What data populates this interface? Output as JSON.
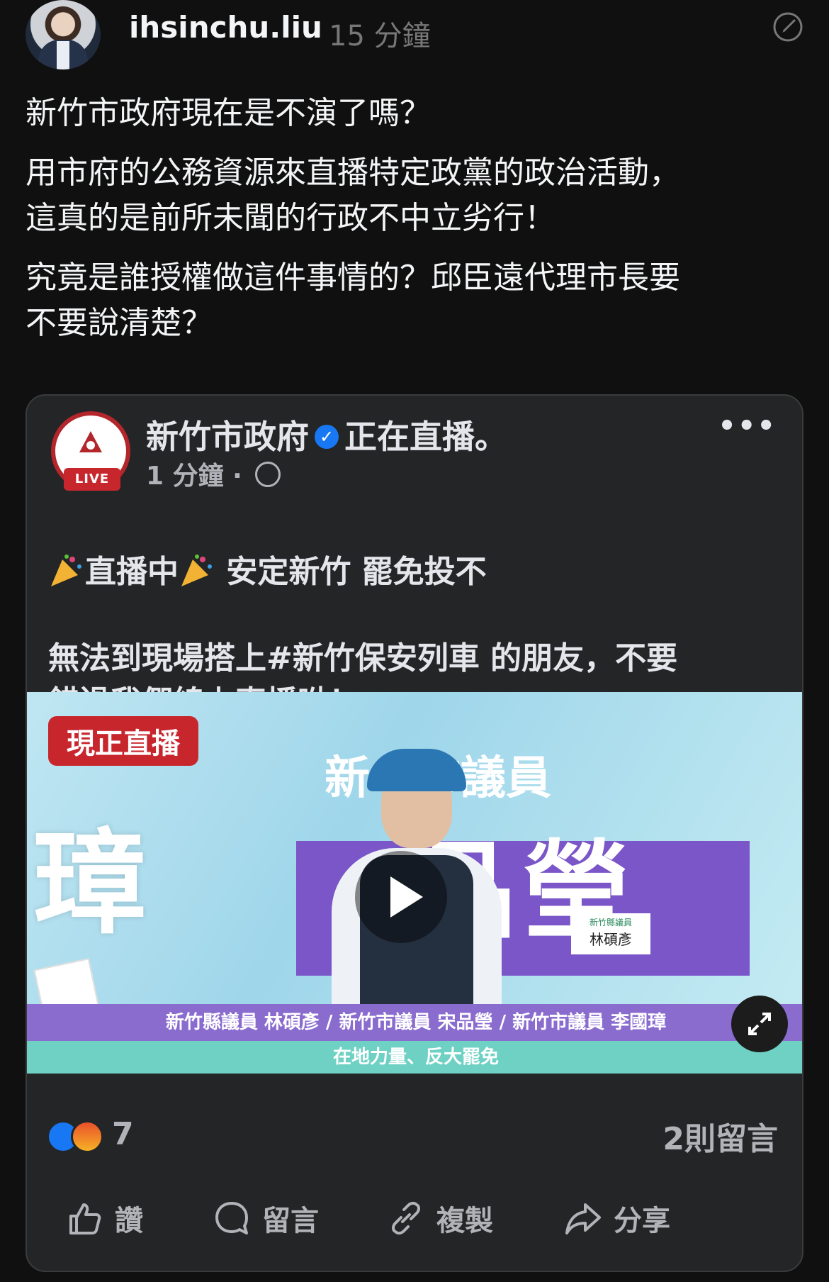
{
  "post": {
    "username": "ihsinchu.liu",
    "timestamp": "15 分鐘",
    "paragraphs": [
      "新竹市政府現在是不演了嗎？",
      "用市府的公務資源來直播特定政黨的政治活動，\n這真的是前所未聞的行政不中立劣行！",
      "究竟是誰授權做這件事情的？邱臣遠代理市長要\n不要說清楚？"
    ]
  },
  "card": {
    "page_name": "新竹市政府",
    "live_status": "正在直播。",
    "live_badge": "LIVE",
    "time": "1 分鐘 · ",
    "line1_a": "直播中",
    "line1_b": "安定新竹 罷免投不",
    "line2": "無法到現場搭上#新竹保安列車 的朋友，不要\n錯過我們線上直播呦！",
    "video": {
      "live_now": "現正直播",
      "name_tag": "林碩彥",
      "ticker_top": "新竹縣議員 林碩彥 / 新竹市議員 宋品瑩 / 新竹市議員 李國璋",
      "ticker_bottom": "在地力量、反大罷免"
    },
    "reaction_count": "7",
    "comment_count": "2則留言",
    "actions": {
      "like": "讚",
      "comment": "留言",
      "copy": "複製",
      "share": "分享"
    }
  }
}
